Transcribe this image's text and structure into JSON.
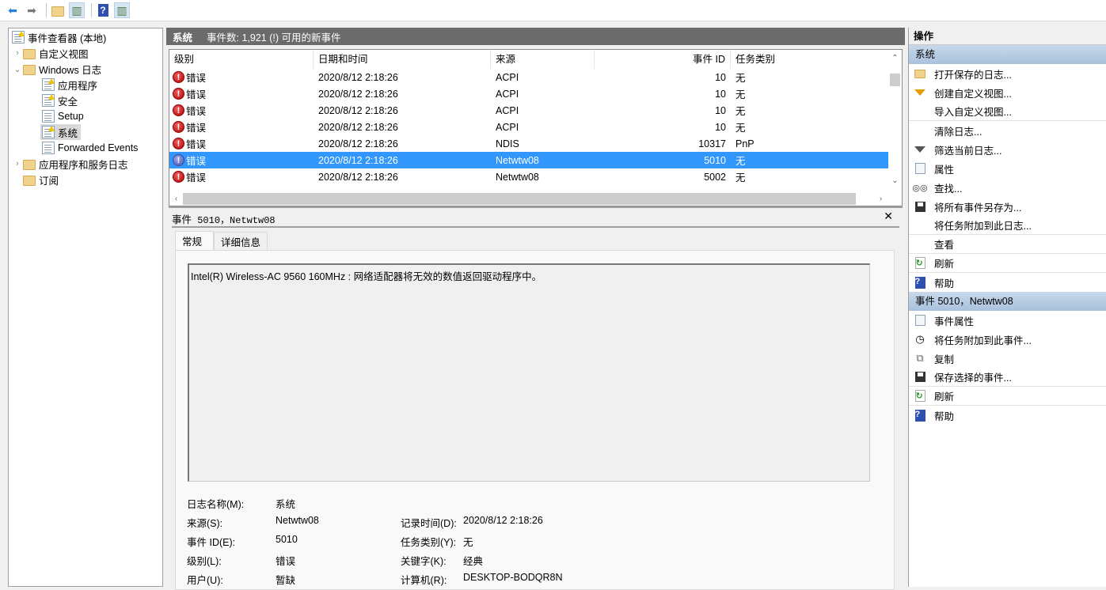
{
  "toolbar": {
    "buttons": [
      {
        "icon": "back-arrow-icon",
        "glyph": "⬅"
      },
      {
        "icon": "forward-arrow-icon",
        "glyph": "➡"
      },
      {
        "icon": "up-folder-icon",
        "glyph": "📂"
      },
      {
        "icon": "show-hide-console-tree-icon",
        "glyph": "▥"
      },
      {
        "icon": "help-icon",
        "glyph": "?"
      },
      {
        "icon": "show-hide-action-pane-icon",
        "glyph": "▥"
      }
    ]
  },
  "tree": {
    "root": "事件查看器 (本地)",
    "custom_views": "自定义视图",
    "windows_logs": "Windows 日志",
    "application": "应用程序",
    "security": "安全",
    "setup": "Setup",
    "system": "系统",
    "forwarded": "Forwarded Events",
    "app_service_logs": "应用程序和服务日志",
    "subscriptions": "订阅"
  },
  "main": {
    "log_name": "系统",
    "event_count": "事件数: 1,921 (!) 可用的新事件",
    "columns": [
      "级别",
      "日期和时间",
      "来源",
      "事件 ID",
      "任务类别"
    ],
    "rows": [
      {
        "level": "错误",
        "datetime": "2020/8/12 2:18:26",
        "source": "ACPI",
        "event_id": "10",
        "task": "无",
        "selected": false
      },
      {
        "level": "错误",
        "datetime": "2020/8/12 2:18:26",
        "source": "ACPI",
        "event_id": "10",
        "task": "无",
        "selected": false
      },
      {
        "level": "错误",
        "datetime": "2020/8/12 2:18:26",
        "source": "ACPI",
        "event_id": "10",
        "task": "无",
        "selected": false
      },
      {
        "level": "错误",
        "datetime": "2020/8/12 2:18:26",
        "source": "ACPI",
        "event_id": "10",
        "task": "无",
        "selected": false
      },
      {
        "level": "错误",
        "datetime": "2020/8/12 2:18:26",
        "source": "NDIS",
        "event_id": "10317",
        "task": "PnP",
        "selected": false
      },
      {
        "level": "错误",
        "datetime": "2020/8/12 2:18:26",
        "source": "Netwtw08",
        "event_id": "5010",
        "task": "无",
        "selected": true
      },
      {
        "level": "错误",
        "datetime": "2020/8/12 2:18:26",
        "source": "Netwtw08",
        "event_id": "5002",
        "task": "无",
        "selected": false
      }
    ]
  },
  "detail": {
    "title_prefix": "事件",
    "title_rest": " 5010，Netwtw08",
    "tabs": [
      "常规",
      "详细信息"
    ],
    "description": "Intel(R) Wireless-AC 9560 160MHz : 网络适配器将无效的数值返回驱动程序中。",
    "fields": {
      "log_name_label": "日志名称(M):",
      "log_name": "系统",
      "source_label": "来源(S):",
      "source": "Netwtw08",
      "logged_label": "记录时间(D):",
      "logged": "2020/8/12 2:18:26",
      "event_id_label": "事件 ID(E):",
      "event_id": "5010",
      "task_label": "任务类别(Y):",
      "task": "无",
      "level_label": "级别(L):",
      "level": "错误",
      "keywords_label": "关键字(K):",
      "keywords": "经典",
      "user_label": "用户(U):",
      "user": "暂缺",
      "computer_label": "计算机(R):",
      "computer": "DESKTOP-BODQR8N"
    }
  },
  "actions": {
    "header": "操作",
    "section1": "系统",
    "items1": [
      "打开保存的日志...",
      "创建自定义视图...",
      "导入自定义视图...",
      "清除日志...",
      "筛选当前日志...",
      "属性",
      "查找...",
      "将所有事件另存为...",
      "将任务附加到此日志...",
      "查看",
      "刷新",
      "帮助"
    ],
    "section2": "事件 5010，Netwtw08",
    "items2": [
      "事件属性",
      "将任务附加到此事件...",
      "复制",
      "保存选择的事件...",
      "刷新",
      "帮助"
    ]
  }
}
